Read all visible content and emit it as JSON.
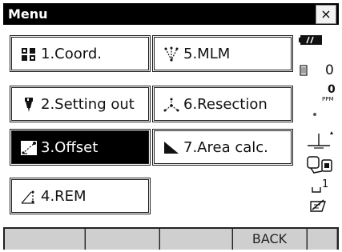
{
  "window": {
    "title": "Menu",
    "close_glyph": "×"
  },
  "menu": [
    {
      "label": "1.Coord.",
      "icon": "coord-icon"
    },
    {
      "label": "2.Setting out",
      "icon": "setting-out-icon"
    },
    {
      "label": "3.Offset",
      "icon": "offset-icon",
      "selected": true
    },
    {
      "label": "4.REM",
      "icon": "rem-icon"
    },
    {
      "label": "5.MLM",
      "icon": "mlm-icon"
    },
    {
      "label": "6.Resection",
      "icon": "resection-icon"
    },
    {
      "label": "7.Area calc.",
      "icon": "area-calc-icon"
    }
  ],
  "status": {
    "battery_icon": "battery-icon",
    "target_constant": "0",
    "ppm_value": "0",
    "ppm_unit": "PPM",
    "tilt_icon": "tilt-icon",
    "comm_icon": "communication-icon",
    "input_mode_value": "1",
    "input_mode_icon": "input-mode-icon",
    "keyboard_icon": "keyboard-icon"
  },
  "softkeys": [
    "",
    "",
    "",
    "BACK",
    ""
  ],
  "colors": {
    "title_bg": "#000000",
    "selected_bg": "#000000",
    "softkey_bg": "#cfcfcf"
  }
}
